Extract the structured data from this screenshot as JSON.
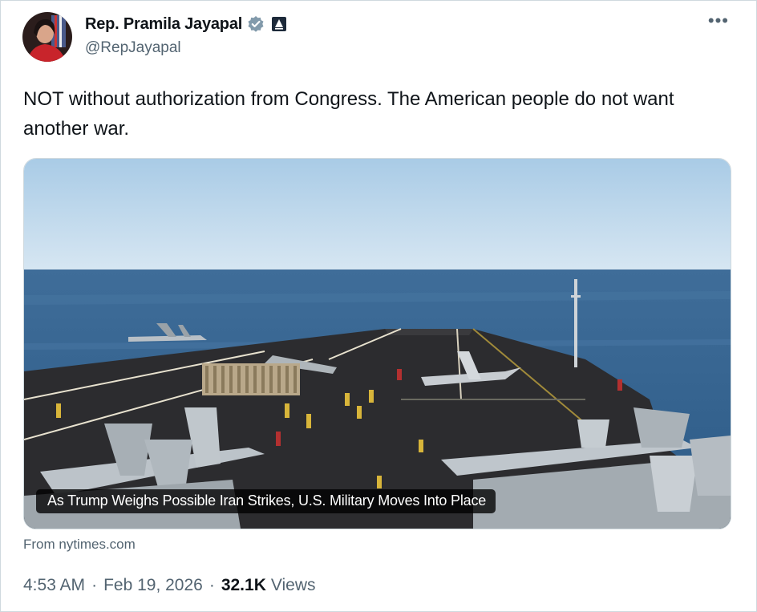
{
  "author": {
    "name": "Rep. Pramila Jayapal",
    "handle": "@RepJayapal",
    "verified_icon": "verified-badge-icon",
    "affiliation_icon": "government-badge-icon"
  },
  "more_icon": "more-horizontal-icon",
  "tweet": {
    "text": "NOT without authorization from Congress. The American people do not want another war."
  },
  "card": {
    "caption": "As Trump Weighs Possible Iran Strikes, U.S. Military Moves Into Place",
    "source": "From nytimes.com"
  },
  "meta": {
    "time": "4:53 AM",
    "date": "Feb 19, 2026",
    "separator": "·",
    "views_count": "32.1K",
    "views_label": "Views"
  },
  "colors": {
    "text": "#0f1419",
    "secondary": "#536471",
    "verified": "#829aab",
    "border": "#cfd9de"
  }
}
